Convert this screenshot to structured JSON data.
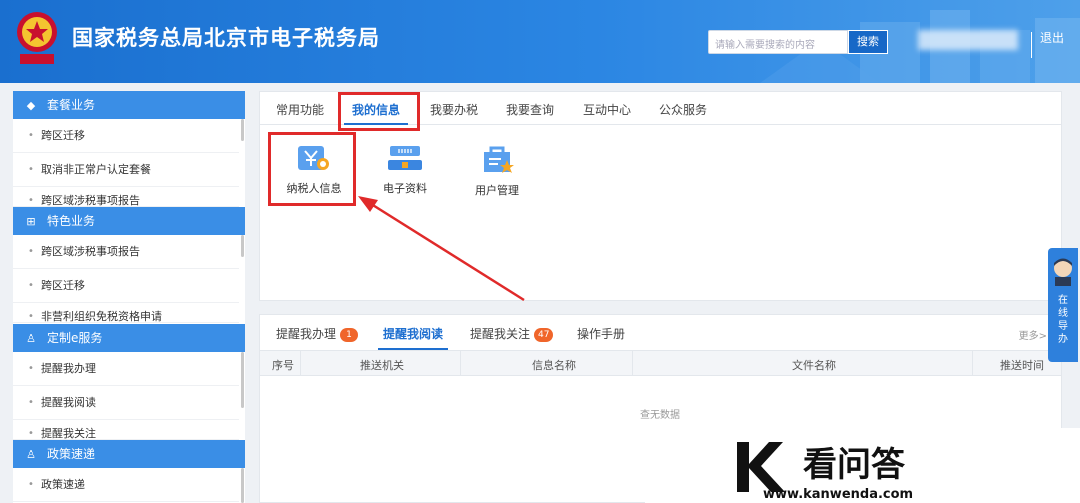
{
  "header": {
    "site_title": "国家税务总局北京市电子税务局",
    "search_placeholder": "请输入需要搜索的内容",
    "search_button": "搜索",
    "logout": "退出"
  },
  "sidebar": {
    "sections": [
      {
        "title": "套餐业务",
        "icon": "cube-icon",
        "items": [
          "跨区迁移",
          "取消非正常户认定套餐",
          "跨区域涉税事项报告"
        ]
      },
      {
        "title": "特色业务",
        "icon": "grid-icon",
        "items": [
          "跨区域涉税事项报告",
          "跨区迁移",
          "非营利组织免税资格申请"
        ]
      },
      {
        "title": "定制e服务",
        "icon": "person-icon",
        "items": [
          "提醒我办理",
          "提醒我阅读",
          "提醒我关注"
        ]
      },
      {
        "title": "政策速递",
        "icon": "person-icon",
        "items": [
          "政策速递"
        ]
      }
    ]
  },
  "main": {
    "tabs": [
      "常用功能",
      "我的信息",
      "我要办税",
      "我要查询",
      "互动中心",
      "公众服务"
    ],
    "active_tab": "我的信息",
    "functions": [
      {
        "label": "纳税人信息",
        "icon": "taxpayer-info-icon"
      },
      {
        "label": "电子资料",
        "icon": "electronic-data-icon"
      },
      {
        "label": "用户管理",
        "icon": "user-management-icon"
      }
    ]
  },
  "reminders": {
    "tabs": [
      {
        "label": "提醒我办理",
        "badge": "1"
      },
      {
        "label": "提醒我阅读",
        "badge": ""
      },
      {
        "label": "提醒我关注",
        "badge": "47"
      },
      {
        "label": "操作手册",
        "badge": ""
      }
    ],
    "more": "更多>",
    "columns": [
      "序号",
      "推送机关",
      "信息名称",
      "文件名称",
      "推送时间"
    ],
    "empty_text": "查无数据"
  },
  "guide": {
    "text": "在线导办"
  },
  "watermark": {
    "brand": "看问答",
    "url": "www.kanwenda.com"
  },
  "colors": {
    "primary": "#1e6fd0",
    "header": "#2b86e3",
    "highlight": "#e02a2a",
    "badge": "#f0652a"
  }
}
